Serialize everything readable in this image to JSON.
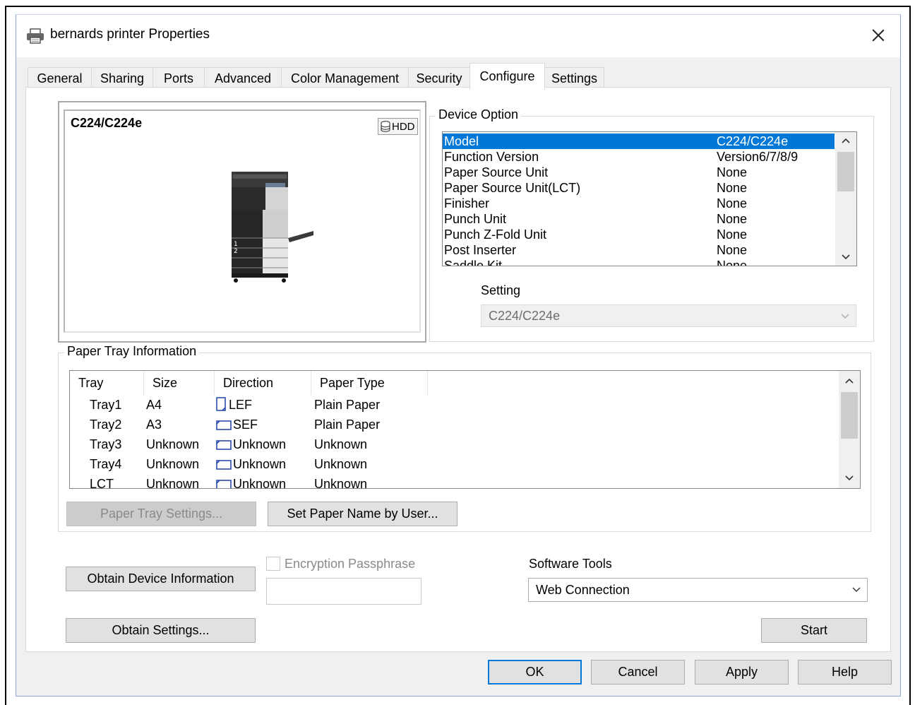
{
  "window": {
    "title": "bernards printer Properties"
  },
  "tabs": [
    {
      "label": "General"
    },
    {
      "label": "Sharing"
    },
    {
      "label": "Ports"
    },
    {
      "label": "Advanced"
    },
    {
      "label": "Color Management"
    },
    {
      "label": "Security"
    },
    {
      "label": "Configure"
    },
    {
      "label": "Settings"
    }
  ],
  "active_tab": "Configure",
  "preview": {
    "model": "C224/C224e",
    "hdd_badge": "HDD",
    "tray_marks": [
      "1",
      "2"
    ]
  },
  "device_option": {
    "label": "Device Option",
    "rows": [
      {
        "name": "Model",
        "value": "C224/C224e"
      },
      {
        "name": "Function Version",
        "value": "Version6/7/8/9"
      },
      {
        "name": "Paper Source Unit",
        "value": "None"
      },
      {
        "name": "Paper Source Unit(LCT)",
        "value": "None"
      },
      {
        "name": "Finisher",
        "value": "None"
      },
      {
        "name": "Punch Unit",
        "value": "None"
      },
      {
        "name": "Punch Z-Fold Unit",
        "value": "None"
      },
      {
        "name": "Post Inserter",
        "value": "None"
      },
      {
        "name": "Saddle Kit",
        "value": "None"
      }
    ],
    "selected_index": 0,
    "setting_label": "Setting",
    "setting_value": "C224/C224e"
  },
  "paper_tray": {
    "label": "Paper Tray Information",
    "columns": [
      "Tray",
      "Size",
      "Direction",
      "Paper Type"
    ],
    "rows": [
      {
        "tray": "Tray1",
        "size": "A4",
        "direction": "LEF",
        "type": "Plain Paper"
      },
      {
        "tray": "Tray2",
        "size": "A3",
        "direction": "SEF",
        "type": "Plain Paper"
      },
      {
        "tray": "Tray3",
        "size": "Unknown",
        "direction": "Unknown",
        "type": "Unknown"
      },
      {
        "tray": "Tray4",
        "size": "Unknown",
        "direction": "Unknown",
        "type": "Unknown"
      },
      {
        "tray": "LCT",
        "size": "Unknown",
        "direction": "Unknown",
        "type": "Unknown"
      }
    ],
    "tray_settings_button": "Paper Tray Settings...",
    "set_name_button": "Set Paper Name by User..."
  },
  "bottom": {
    "obtain_device_info": "Obtain Device Information",
    "obtain_settings": "Obtain Settings...",
    "encryption_label": "Encryption Passphrase",
    "encryption_value": "",
    "software_tools_label": "Software Tools",
    "software_tools_value": "Web Connection",
    "start_button": "Start"
  },
  "dialog_buttons": {
    "ok": "OK",
    "cancel": "Cancel",
    "apply": "Apply",
    "help": "Help"
  },
  "colors": {
    "accent": "#0078d7",
    "window_bg": "#f0f0f0",
    "page_bg": "#ffffff"
  }
}
